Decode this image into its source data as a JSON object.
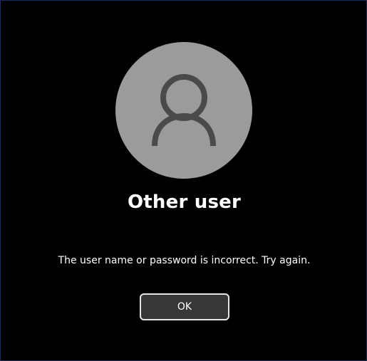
{
  "user": {
    "display_name": "Other user",
    "avatar_icon": "person-icon",
    "avatar_color": "#9b9b9b"
  },
  "error": {
    "message": "The user name or password is incorrect. Try again."
  },
  "actions": {
    "ok_label": "OK"
  }
}
